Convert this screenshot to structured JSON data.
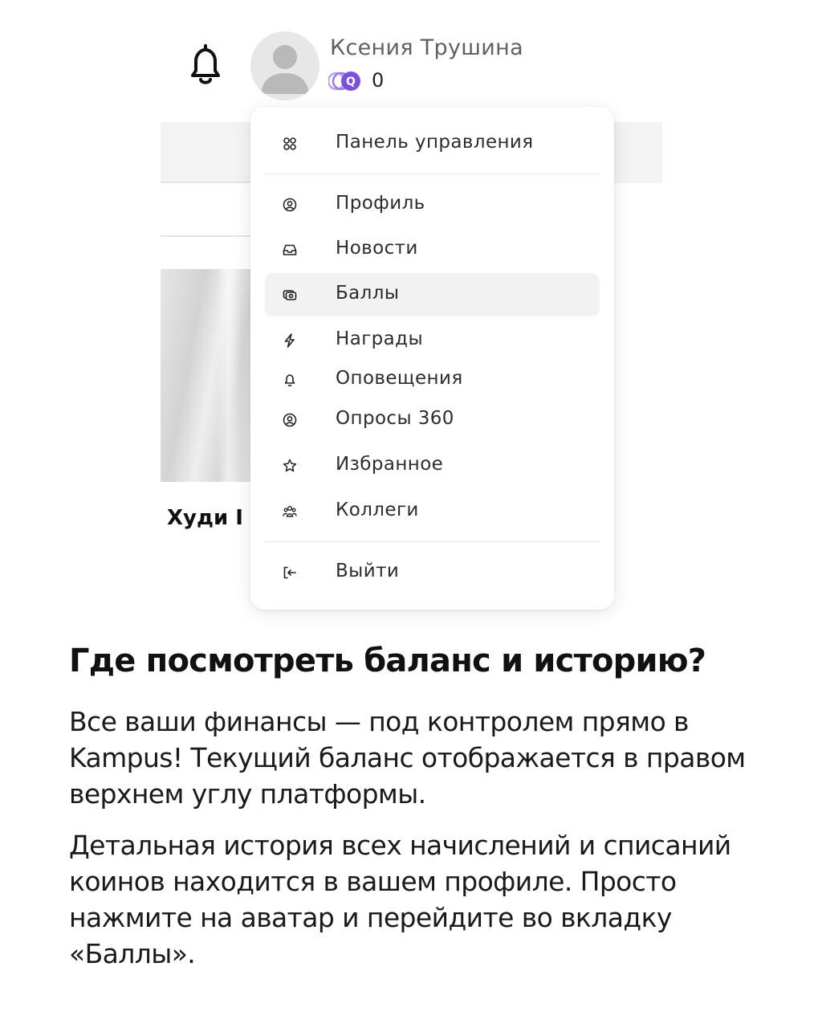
{
  "header": {
    "user_name": "Ксения Трушина",
    "coin_balance": "0"
  },
  "product": {
    "title_visible": "Худи I"
  },
  "menu": {
    "items": [
      {
        "label": "Панель управления",
        "icon": "dashboard-icon"
      },
      {
        "label": "Профиль",
        "icon": "user-circle-icon"
      },
      {
        "label": "Новости",
        "icon": "inbox-icon"
      },
      {
        "label": "Баллы",
        "icon": "coins-icon",
        "active": true
      },
      {
        "label": "Награды",
        "icon": "lightning-icon"
      },
      {
        "label": "Оповещения",
        "icon": "bell-icon"
      },
      {
        "label": "Опросы 360",
        "icon": "user-circle-icon"
      },
      {
        "label": "Избранное",
        "icon": "star-icon"
      },
      {
        "label": "Коллеги",
        "icon": "users-icon"
      },
      {
        "label": "Выйти",
        "icon": "logout-icon"
      }
    ]
  },
  "article": {
    "heading": "Где посмотреть баланс и историю?",
    "para1": "Все ваши финансы — под контролем прямо в Kampus! Текущий баланс отображается в правом верхнем углу платформы.",
    "para2": "Детальная история всех начислений и списаний коинов находится в вашем профиле. Просто нажмите на аватар и перейдите во вкладку «Баллы»."
  },
  "colors": {
    "coin_purple": "#7b4fe0",
    "active_bg": "#f2f2f2"
  }
}
